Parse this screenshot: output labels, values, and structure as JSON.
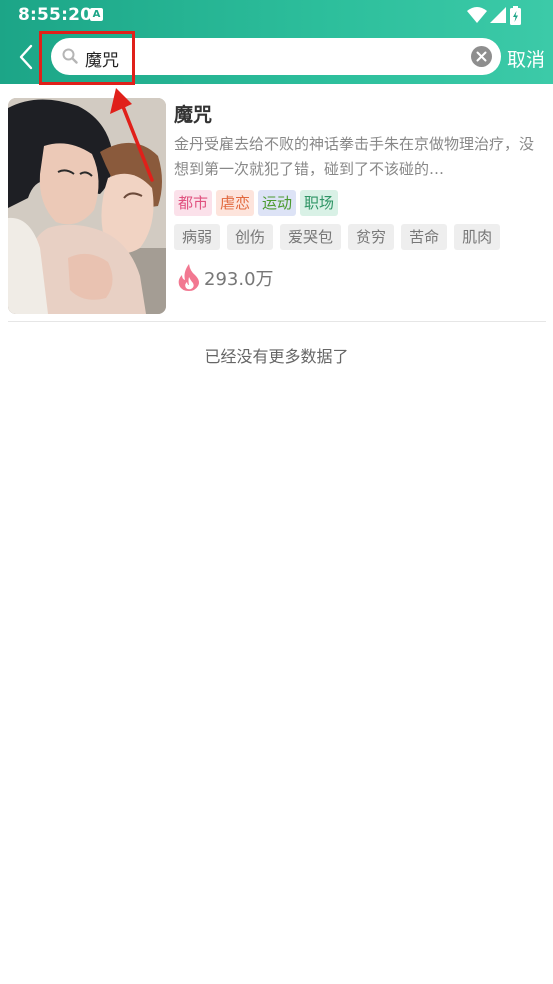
{
  "status_bar": {
    "time": "8:55:20",
    "notification_glyph": "A",
    "icons": [
      "wifi-icon",
      "signal-icon",
      "battery-charging-icon"
    ]
  },
  "search": {
    "back_icon": "chevron-left-icon",
    "query": "魔咒",
    "search_icon": "search-icon",
    "clear_icon": "clear-icon",
    "cancel_label": "取消"
  },
  "results": [
    {
      "title": "魔咒",
      "description": "金丹受雇去给不败的神话拳击手朱在京做物理治疗，没想到第一次就犯了错，碰到了不该碰的…",
      "category_tags": [
        "都市",
        "虐恋",
        "运动",
        "职场"
      ],
      "keyword_tags": [
        "病弱",
        "创伤",
        "爱哭包",
        "贫穷",
        "苦命",
        "肌肉"
      ],
      "heat_icon": "flame-icon",
      "heat": "293.0万"
    }
  ],
  "footer": {
    "no_more_text": "已经没有更多数据了"
  },
  "colors": {
    "header_start": "#1ca587",
    "header_end": "#3ccaa8",
    "annotation": "#e0201a",
    "flame": "#f0526a"
  }
}
